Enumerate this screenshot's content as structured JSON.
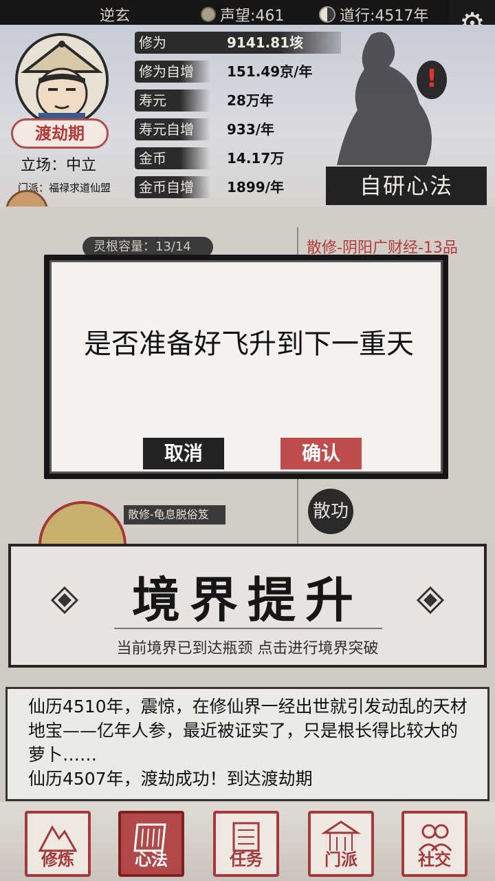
{
  "topbar": {
    "player_name": "逆玄",
    "reputation": "声望:461",
    "dao_practice": "道行:4517年"
  },
  "profile": {
    "realm": "渡劫期",
    "stance": "立场：中立",
    "sect": "门派：福禄求道仙盟"
  },
  "stats": [
    {
      "label": "修为",
      "value": "9141.81垓"
    },
    {
      "label": "修为自增",
      "value": "151.49京/年"
    },
    {
      "label": "寿元",
      "value": "28万年"
    },
    {
      "label": "寿元自增",
      "value": "933/年"
    },
    {
      "label": "金币",
      "value": "14.17万"
    },
    {
      "label": "金币自增",
      "value": "1899/年"
    }
  ],
  "self_research_label": "自研心法",
  "middle": {
    "root_capacity": "灵根容量：13/14",
    "technique_title": "散修-阴阳广财经-13品",
    "skill_tag": "散修-龟息脱俗笈",
    "disperse_label": "散功"
  },
  "dialog": {
    "message": "是否准备好飞升到下一重天",
    "cancel_label": "取消",
    "confirm_label": "确认"
  },
  "realm_panel": {
    "title": "境界提升",
    "subtitle": "当前境界已到达瓶颈 点击进行境界突破"
  },
  "log": [
    "仙历4510年，震惊，在修仙界一经出世就引发动乱的天材地宝——亿年人参，最近被证实了，只是根长得比较大的萝卜……",
    "仙历4507年，渡劫成功！到达渡劫期"
  ],
  "nav": [
    {
      "label": "修炼",
      "icon": "mountain-icon"
    },
    {
      "label": "心法",
      "icon": "scroll-icon"
    },
    {
      "label": "任务",
      "icon": "task-scroll-icon"
    },
    {
      "label": "门派",
      "icon": "pavilion-icon"
    },
    {
      "label": "社交",
      "icon": "people-icon"
    }
  ],
  "colors": {
    "accent_red": "#b24848",
    "ink": "#161616",
    "paper": "#f4f1ef"
  }
}
